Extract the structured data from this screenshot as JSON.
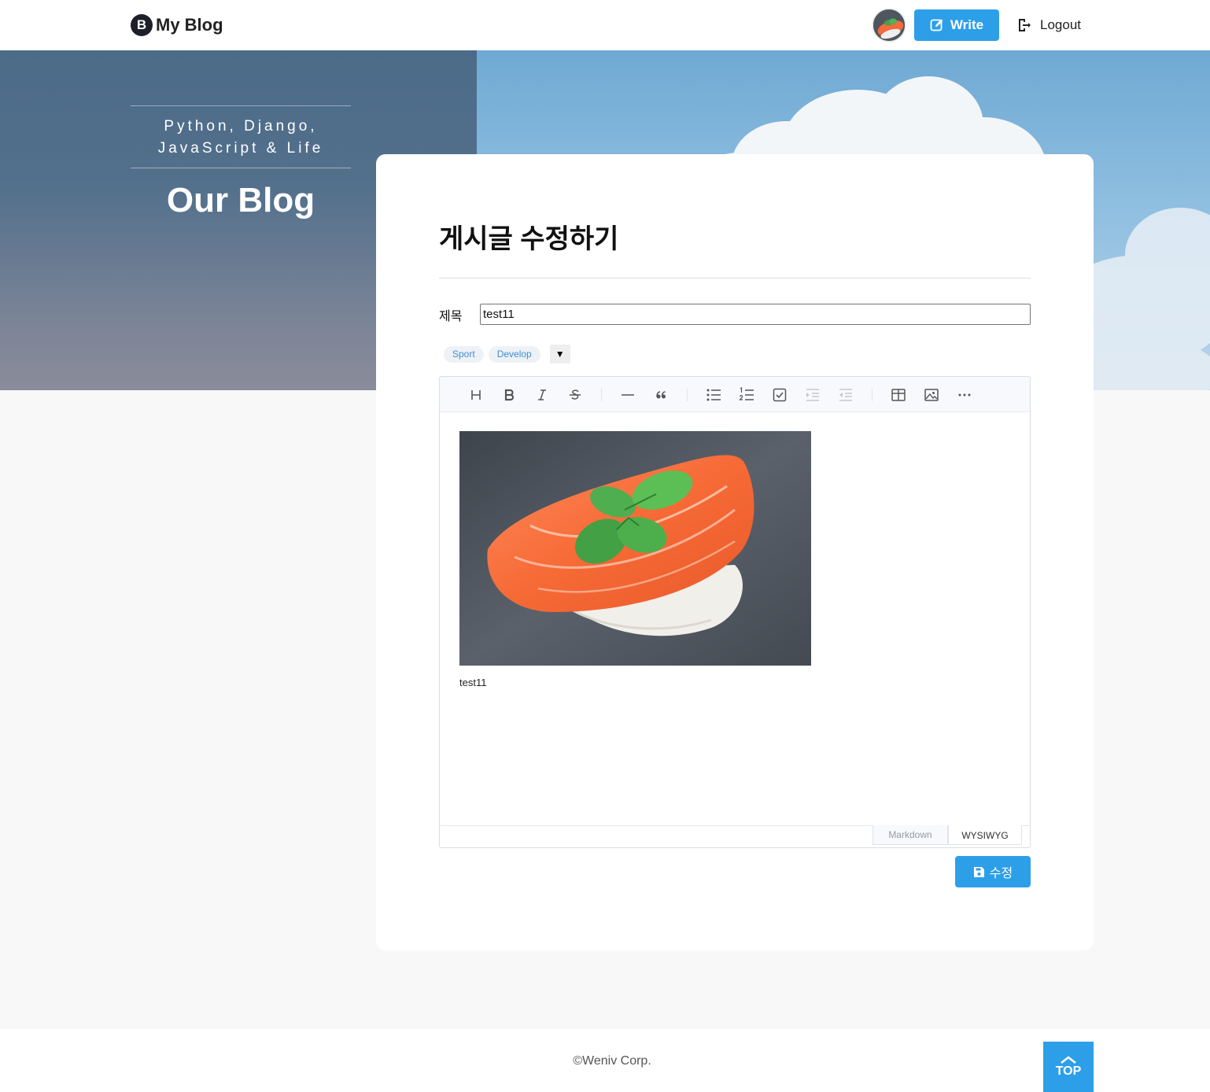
{
  "header": {
    "logo_letter": "B",
    "logo_text": "My Blog",
    "write_label": "Write",
    "logout_label": "Logout"
  },
  "hero": {
    "tagline_line1": "Python, Django,",
    "tagline_line2": "JavaScript & Life",
    "title": "Our Blog"
  },
  "form": {
    "page_title": "게시글 수정하기",
    "title_label": "제목",
    "title_value": "test11",
    "tags": [
      "Sport",
      "Develop"
    ],
    "tag_dropdown_symbol": "▼",
    "save_label": "수정"
  },
  "editor": {
    "toolbar_icons": [
      "heading-icon",
      "bold-icon",
      "italic-icon",
      "strike-icon",
      "hr-icon",
      "quote-icon",
      "bullet-list-icon",
      "ordered-list-icon",
      "task-list-icon",
      "indent-icon",
      "outdent-icon",
      "table-icon",
      "image-icon",
      "more-icon"
    ],
    "body_text": "test11",
    "mode_markdown": "Markdown",
    "mode_wysiwyg": "WYSIWYG",
    "active_mode": "WYSIWYG"
  },
  "footer": {
    "copyright": "©Weniv Corp.",
    "top_label": "TOP"
  },
  "colors": {
    "accent": "#2d9fe8",
    "page_background": "#f8f8f8",
    "tag_text": "#3f8ed6"
  }
}
